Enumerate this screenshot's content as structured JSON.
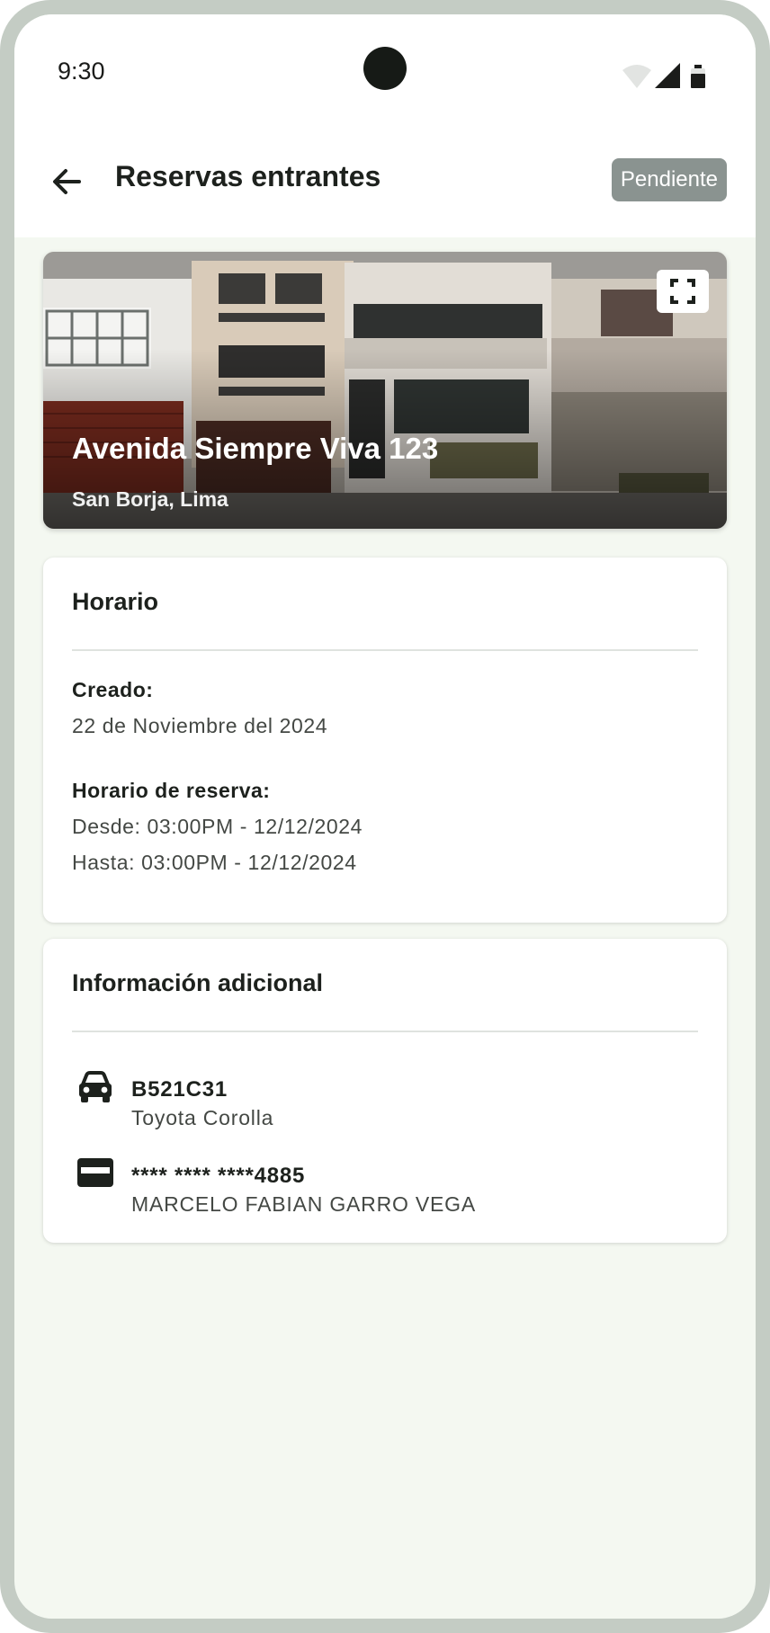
{
  "status_bar": {
    "time": "9:30",
    "icons": [
      "wifi-icon",
      "signal-icon",
      "battery-icon"
    ]
  },
  "app_bar": {
    "title": "Reservas entrantes",
    "status_badge": "Pendiente",
    "back_icon": "arrow-left-icon"
  },
  "hero": {
    "address": "Avenida Siempre Viva 123",
    "district": "San Borja, Lima",
    "expand_icon": "fullscreen-icon"
  },
  "schedule": {
    "title": "Horario",
    "created_label": "Creado:",
    "created_value": "22 de Noviembre del 2024",
    "reservation_label": "Horario de reserva:",
    "from": "Desde: 03:00PM - 12/12/2024",
    "to": "Hasta: 03:00PM - 12/12/2024"
  },
  "additional": {
    "title": "Información adicional",
    "vehicle": {
      "icon": "car-icon",
      "plate": "B521C31",
      "model": "Toyota Corolla"
    },
    "payment": {
      "icon": "credit-card-icon",
      "card_number": "**** **** ****4885",
      "holder": "MARCELO FABIAN GARRO VEGA"
    }
  },
  "colors": {
    "background": "#f4f8f1",
    "badge": "#8a9390",
    "frame": "#c4ccc4"
  }
}
